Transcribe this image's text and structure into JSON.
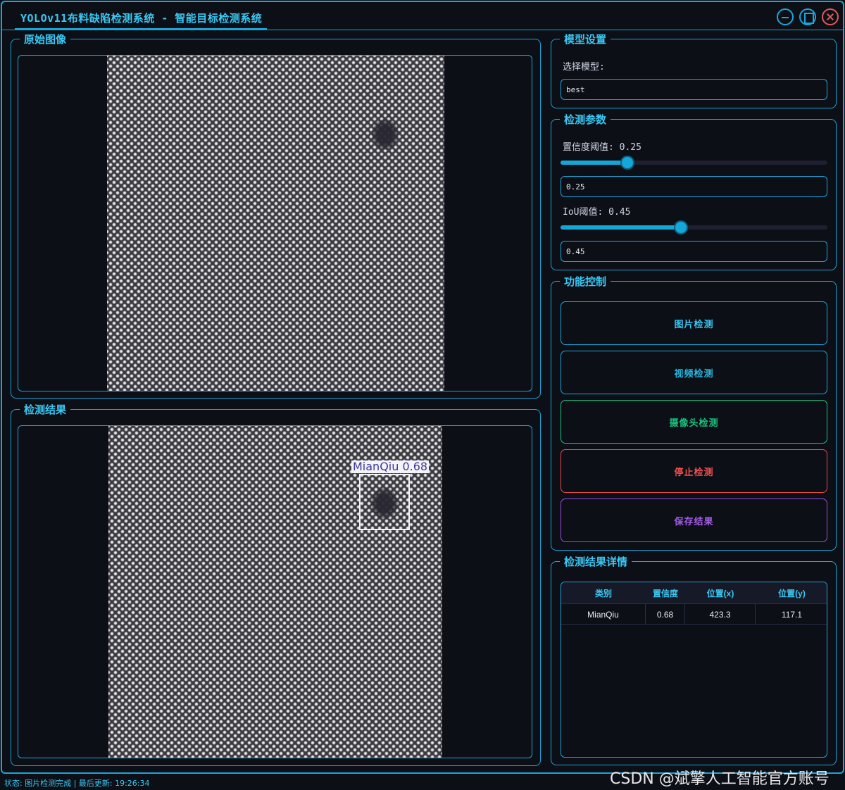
{
  "window": {
    "title": "YOLOv11布料缺陷检测系统 - 智能目标检测系统"
  },
  "panels": {
    "original_title": "原始图像",
    "result_title": "检测结果"
  },
  "detection_overlay": {
    "label": "MianQiu 0.68"
  },
  "model": {
    "title": "模型设置",
    "select_label": "选择模型:",
    "selected": "best"
  },
  "params": {
    "title": "检测参数",
    "confidence_label": "置信度阈值: 0.25",
    "confidence_value": "0.25",
    "confidence_fraction": 0.25,
    "iou_label": "IoU阈值: 0.45",
    "iou_value": "0.45",
    "iou_fraction": 0.45
  },
  "controls": {
    "title": "功能控制",
    "image_detect": "图片检测",
    "video_detect": "视频检测",
    "camera_detect": "摄像头检测",
    "stop_detect": "停止检测",
    "save_result": "保存结果"
  },
  "results": {
    "title": "检测结果详情",
    "columns": [
      "类别",
      "置信度",
      "位置(x)",
      "位置(y)"
    ],
    "rows": [
      [
        "MianQiu",
        "0.68",
        "423.3",
        "117.1"
      ]
    ]
  },
  "status": {
    "text": "状态: 图片检测完成 | 最后更新: 19:26:34"
  },
  "watermark": "CSDN @斌擎人工智能官方账号",
  "colors": {
    "accent": "#1aa6d9",
    "image_btn": "#1aa6d9",
    "video_btn": "#1aa6d9",
    "camera_btn": "#19c37d",
    "stop_btn": "#e74a4a",
    "save_btn": "#9b4dde"
  }
}
